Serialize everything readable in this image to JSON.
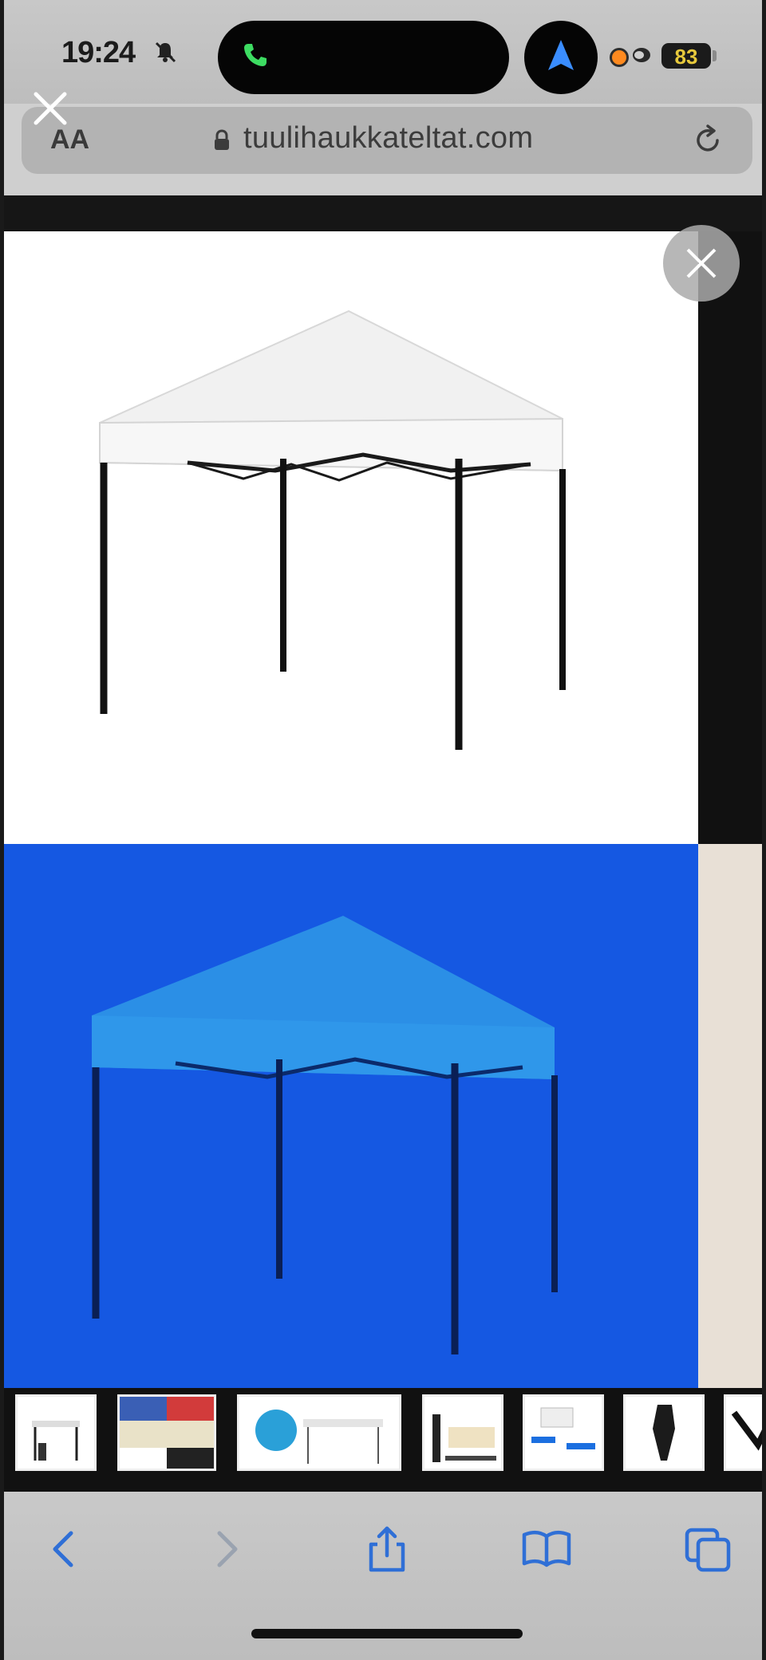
{
  "status_bar": {
    "time": "19:24",
    "battery": "83"
  },
  "browser": {
    "text_size_label": "AA",
    "url": "tuulihaukkateltat.com"
  },
  "gallery": {
    "main_images": [
      "white-canopy-tent",
      "blue-canopy-tent"
    ],
    "thumbnail_count": 8
  },
  "colors": {
    "accent_blue": "#1558e2",
    "battery_text": "#e7c93c",
    "tent_blue": "#2d8ce8"
  },
  "toolbar": {
    "icons": [
      "back-icon",
      "forward-icon",
      "share-icon",
      "bookmarks-icon",
      "tabs-icon"
    ]
  }
}
